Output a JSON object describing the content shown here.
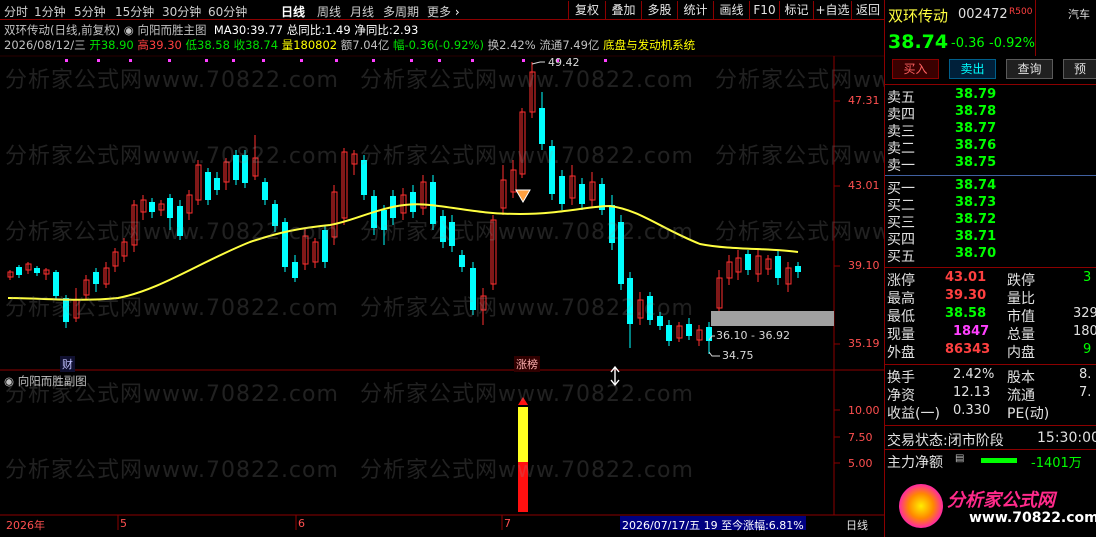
{
  "toolbar": {
    "periods": [
      "分时",
      "1分钟",
      "5分钟",
      "15分钟",
      "30分钟",
      "60分钟",
      "日线",
      "周线",
      "月线",
      "多周期",
      "更多"
    ],
    "active_period": "日线",
    "buttons": [
      "复权",
      "叠加",
      "多股",
      "统计",
      "画线",
      "F10",
      "标记",
      "+自选",
      "返回"
    ]
  },
  "main_chart": {
    "title": "双环传动(日线,前复权)",
    "indicator_name": "向阳而胜主图",
    "ma_label": "MA30:",
    "ma_value": "39.77",
    "total_ratio_label": "总同比:",
    "total_ratio_value": "1.49",
    "net_ratio_label": "净同比:",
    "net_ratio_value": "2.93",
    "date": "2026/08/12/三",
    "open_label": "开",
    "open": "38.90",
    "high_label": "高",
    "high": "39.30",
    "low_label": "低",
    "low": "38.58",
    "close_label": "收",
    "close": "38.74",
    "volume_label": "量",
    "volume": "180802",
    "amount_label": "额",
    "amount": "7.04亿",
    "change_label": "幅",
    "change": "-0.36(-0.92%)",
    "turnover_label": "换",
    "turnover": "2.42%",
    "float_label": "流通",
    "float": "7.49亿",
    "sector": "底盘与发动机系统",
    "price_axis": [
      "47.31",
      "43.01",
      "39.10",
      "35.19"
    ],
    "high_annotation": "49.42",
    "range_annotation": "36.10 - 36.92",
    "low_annotation": "34.75",
    "marker_cai": "财",
    "marker_zhangbang": "涨榜"
  },
  "sub_chart": {
    "title": "向阳而胜副图",
    "axis": [
      "10.00",
      "7.50",
      "5.00"
    ]
  },
  "time_axis": {
    "labels": [
      "2026年",
      "5",
      "6",
      "7"
    ],
    "status": "2026/07/17/五 19 至今涨幅:6.81%",
    "period": "日线"
  },
  "watermark": "分析家公式网www.70822.com",
  "logo": {
    "name": "分析家公式网",
    "url": "www.70822.com"
  },
  "colors": {
    "up": "#ff3030",
    "down": "#00ffff",
    "ma": "#ffff40",
    "border": "#8b0000",
    "bid": "#00ff00"
  },
  "quote": {
    "name": "双环传动",
    "code": "002472",
    "tag": "R500",
    "sector_short": "汽车",
    "price": "38.74",
    "change": "-0.36",
    "change_pct": "-0.92%",
    "buy_btn": "买入",
    "sell_btn": "卖出",
    "query_btn": "查询",
    "extra_btn": "预",
    "asks": [
      {
        "label": "卖五",
        "price": "38.79"
      },
      {
        "label": "卖四",
        "price": "38.78"
      },
      {
        "label": "卖三",
        "price": "38.77"
      },
      {
        "label": "卖二",
        "price": "38.76"
      },
      {
        "label": "卖一",
        "price": "38.75"
      }
    ],
    "bids": [
      {
        "label": "买一",
        "price": "38.74"
      },
      {
        "label": "买二",
        "price": "38.73"
      },
      {
        "label": "买三",
        "price": "38.72"
      },
      {
        "label": "买四",
        "price": "38.71"
      },
      {
        "label": "买五",
        "price": "38.70"
      }
    ],
    "stats": [
      {
        "l1": "涨停",
        "v1": "43.01",
        "l2": "跌停",
        "v2": "3"
      },
      {
        "l1": "最高",
        "v1": "39.30",
        "l2": "量比",
        "v2": ""
      },
      {
        "l1": "最低",
        "v1": "38.58",
        "l2": "市值",
        "v2": "329"
      },
      {
        "l1": "现量",
        "v1": "1847",
        "l2": "总量",
        "v2": "180"
      },
      {
        "l1": "外盘",
        "v1": "86343",
        "l2": "内盘",
        "v2": "9"
      }
    ],
    "stats2": [
      {
        "l1": "换手",
        "v1": "2.42%",
        "l2": "股本",
        "v2": "8."
      },
      {
        "l1": "净资",
        "v1": "12.13",
        "l2": "流通",
        "v2": "7."
      },
      {
        "l1": "收益(一)",
        "v1": "0.330",
        "l2": "PE(动)",
        "v2": ""
      }
    ],
    "trade_status_label": "交易状态:",
    "trade_status": "闭市阶段",
    "trade_time": "15:30:00",
    "main_flow_label": "主力净额",
    "main_flow": "-1401万"
  }
}
